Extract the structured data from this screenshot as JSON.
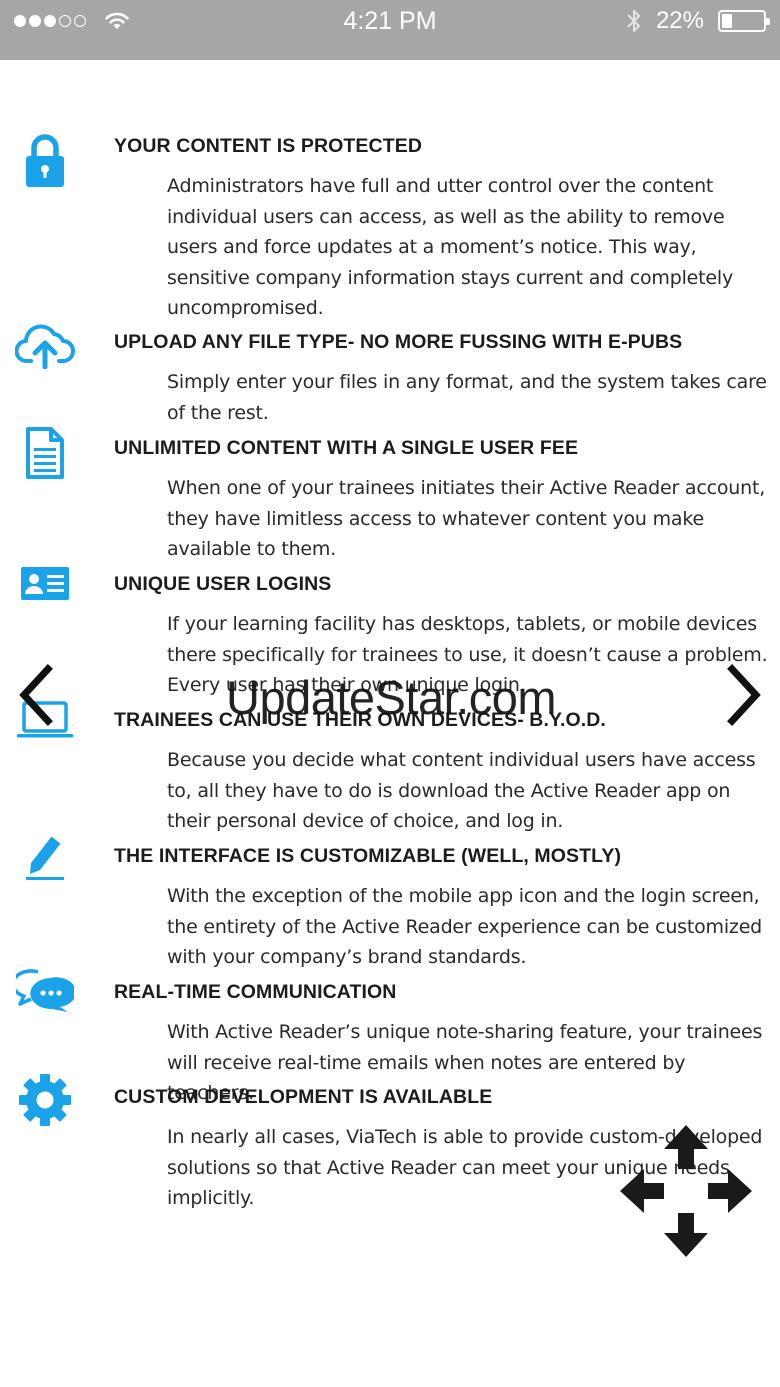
{
  "status_bar": {
    "time": "4:21 PM",
    "battery": "22%",
    "battery_level": 0.22,
    "signal_bars_filled": 3,
    "signal_bars_total": 5
  },
  "features": [
    {
      "icon": "lock-icon",
      "title": "YOUR CONTENT IS PROTECTED",
      "body": "Administrators have full and utter control over the content individual users can access, as well as the ability to remove users and force updates at a moment’s notice. This way, sensitive company information stays current and completely uncompromised."
    },
    {
      "icon": "cloud-upload-icon",
      "title": "UPLOAD ANY FILE TYPE- NO MORE FUSSING WITH E-PUBS",
      "body": "Simply enter your files in any format, and the system takes care of the rest."
    },
    {
      "icon": "document-icon",
      "title": "UNLIMITED CONTENT WITH A SINGLE USER FEE",
      "body": "When one of your trainees initiates their Active Reader account, they have limitless access to whatever content you make available to them."
    },
    {
      "icon": "id-card-icon",
      "title": "UNIQUE USER LOGINS",
      "body": "If your learning facility has desktops, tablets, or mobile devices there specifically for trainees to use, it doesn’t cause a problem. Every user has their own unique login."
    },
    {
      "icon": "laptop-icon",
      "title": "TRAINEES CAN USE THEIR OWN DEVICES- B.Y.O.D.",
      "body": "Because you decide what content individual users have access to, all they have to do is download the Active Reader app on their personal device of choice, and log in."
    },
    {
      "icon": "pencil-icon",
      "title": "THE INTERFACE IS CUSTOMIZABLE (WELL, MOSTLY)",
      "body": "With the exception of the mobile app icon and the login screen, the entirety of the Active Reader experience can be customized with your company’s brand standards."
    },
    {
      "icon": "chat-bubbles-icon",
      "title": "REAL-TIME COMMUNICATION",
      "body": "With Active Reader’s unique note-sharing feature, your trainees will receive real-time emails when notes are entered by teachers."
    },
    {
      "icon": "gear-icon",
      "title": "CUSTOM DEVELOPMENT IS AVAILABLE",
      "body": "In nearly all cases, ViaTech is able to provide custom-developed solutions so that Active Reader can meet your unique needs implicitly."
    }
  ],
  "overlay": {
    "watermark": "UpdateStar.com"
  },
  "colors": {
    "accent": "#1aa3e8",
    "status_bar": "#a6a6a6"
  }
}
